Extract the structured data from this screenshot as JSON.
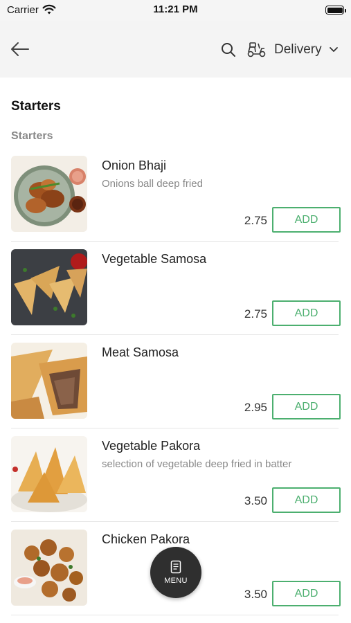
{
  "status_bar": {
    "carrier": "Carrier",
    "time": "11:21 PM"
  },
  "nav": {
    "delivery_label": "Delivery"
  },
  "section": {
    "title": "Starters",
    "subtitle": "Starters"
  },
  "items": [
    {
      "name": "Onion Bhaji",
      "description": "Onions ball deep fried",
      "price": "2.75",
      "add_label": "ADD"
    },
    {
      "name": "Vegetable Samosa",
      "description": "",
      "price": "2.75",
      "add_label": "ADD"
    },
    {
      "name": "Meat Samosa",
      "description": "",
      "price": "2.95",
      "add_label": "ADD"
    },
    {
      "name": "Vegetable Pakora",
      "description": "selection of vegetable deep fried in batter",
      "price": "3.50",
      "add_label": "ADD"
    },
    {
      "name": "Chicken Pakora",
      "description": "",
      "price": "3.50",
      "add_label": "ADD"
    }
  ],
  "fab": {
    "label": "MENU"
  },
  "colors": {
    "accent_green": "#4caf6f",
    "fab_background": "#2f2f2f",
    "header_background": "#f4f4f4"
  }
}
